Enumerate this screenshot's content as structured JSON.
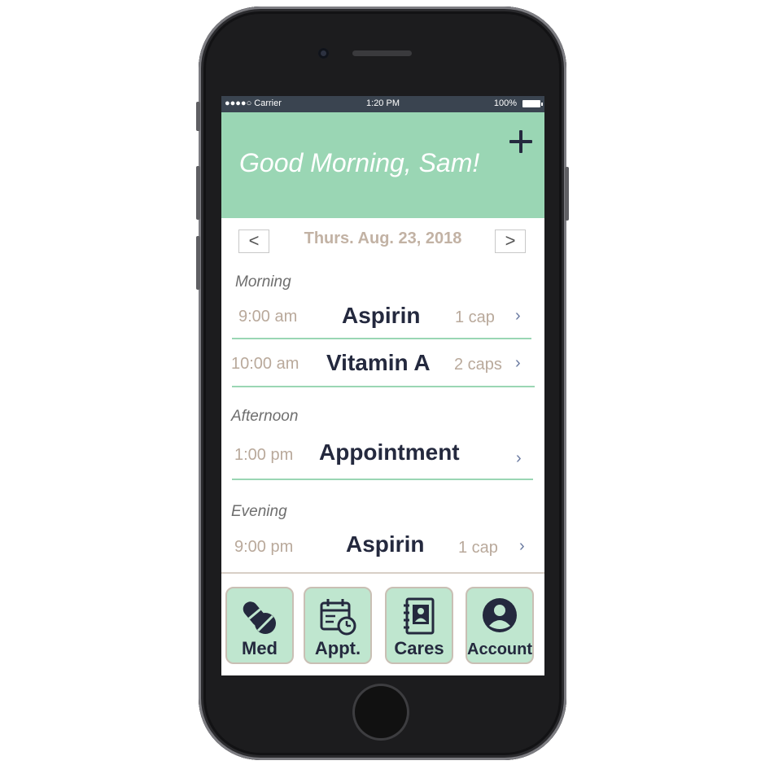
{
  "status_bar": {
    "carrier": "●●●●○ Carrier",
    "time": "1:20 PM",
    "battery": "100%"
  },
  "header": {
    "greeting": "Good Morning, Sam!",
    "add_icon": "plus-icon",
    "color": "#9ad6b4"
  },
  "date_nav": {
    "prev_label": "<",
    "date": "Thurs. Aug. 23, 2018",
    "next_label": ">"
  },
  "sections": [
    {
      "label": "Morning",
      "items": [
        {
          "time": "9:00 am",
          "title": "Aspirin",
          "qty": "1 cap",
          "chevron": "›"
        },
        {
          "time": "10:00 am",
          "title": "Vitamin A",
          "qty": "2 caps",
          "chevron": "›"
        }
      ]
    },
    {
      "label": "Afternoon",
      "items": [
        {
          "time": "1:00 pm",
          "title": "Appointment",
          "qty": "",
          "chevron": "›"
        }
      ]
    },
    {
      "label": "Evening",
      "items": [
        {
          "time": "9:00 pm",
          "title": "Aspirin",
          "qty": "1 cap",
          "chevron": "›"
        }
      ]
    }
  ],
  "tabs": [
    {
      "label": "Med",
      "icon": "pills-icon"
    },
    {
      "label": "Appt.",
      "icon": "calendar-clock-icon"
    },
    {
      "label": "Cares",
      "icon": "contact-book-icon"
    },
    {
      "label": "Account",
      "icon": "user-circle-icon"
    }
  ],
  "colors": {
    "accent": "#9ad6b4",
    "tab_fill": "#bfe6cf",
    "text_dark": "#24293e",
    "text_muted": "#b9a99b"
  }
}
